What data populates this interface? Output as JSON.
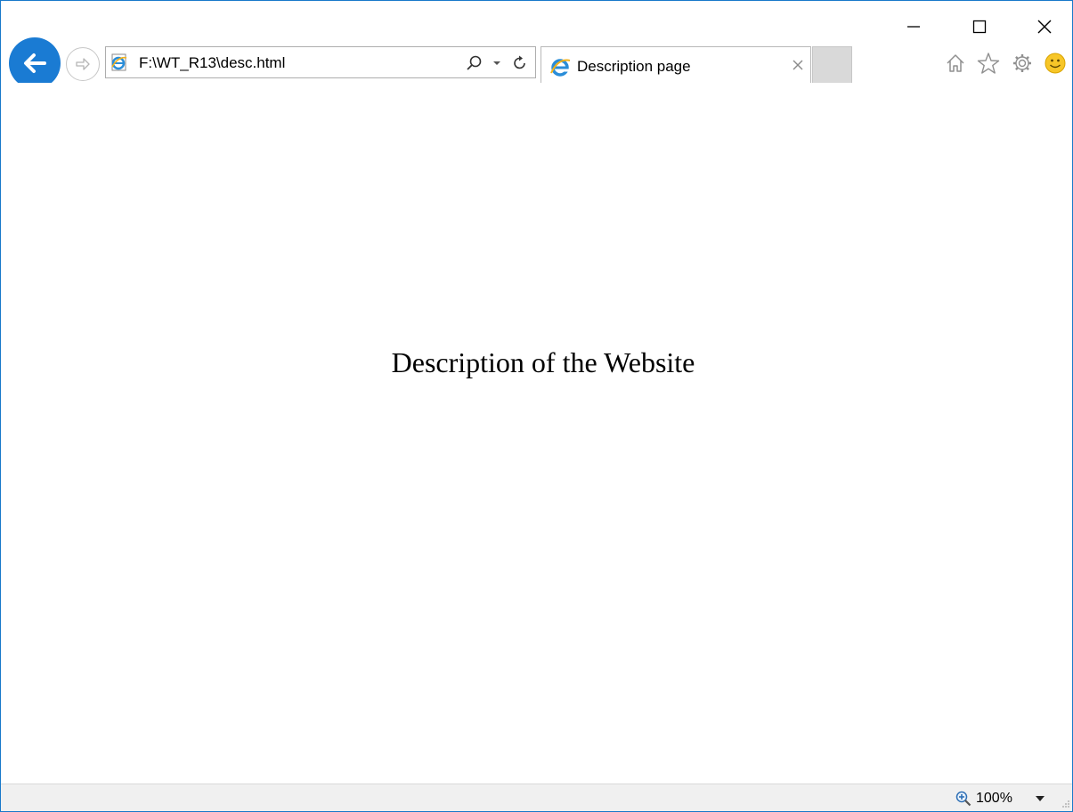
{
  "window": {
    "caption": {
      "minimize": "minimize",
      "maximize": "maximize",
      "close": "close"
    }
  },
  "navigation": {
    "back_icon": "arrow-left-icon",
    "forward_icon": "arrow-right-icon"
  },
  "address_bar": {
    "url": "F:\\WT_R13\\desc.html",
    "icons": [
      "ie-page-icon",
      "search-icon",
      "dropdown-icon",
      "refresh-icon"
    ]
  },
  "tabs": [
    {
      "title": "Description page",
      "icon": "ie-logo-icon",
      "active": true
    }
  ],
  "toolbar": {
    "icons": [
      "home-icon",
      "favorites-star-icon",
      "gear-icon",
      "smiley-feedback-icon"
    ]
  },
  "page": {
    "heading": "Description of the Website"
  },
  "status_bar": {
    "zoom": "100%"
  },
  "colors": {
    "accent_blue": "#1a7bd3",
    "window_border": "#1979ca",
    "status_bg": "#f0f0f0",
    "new_tab_bg": "#d9d9d9"
  }
}
